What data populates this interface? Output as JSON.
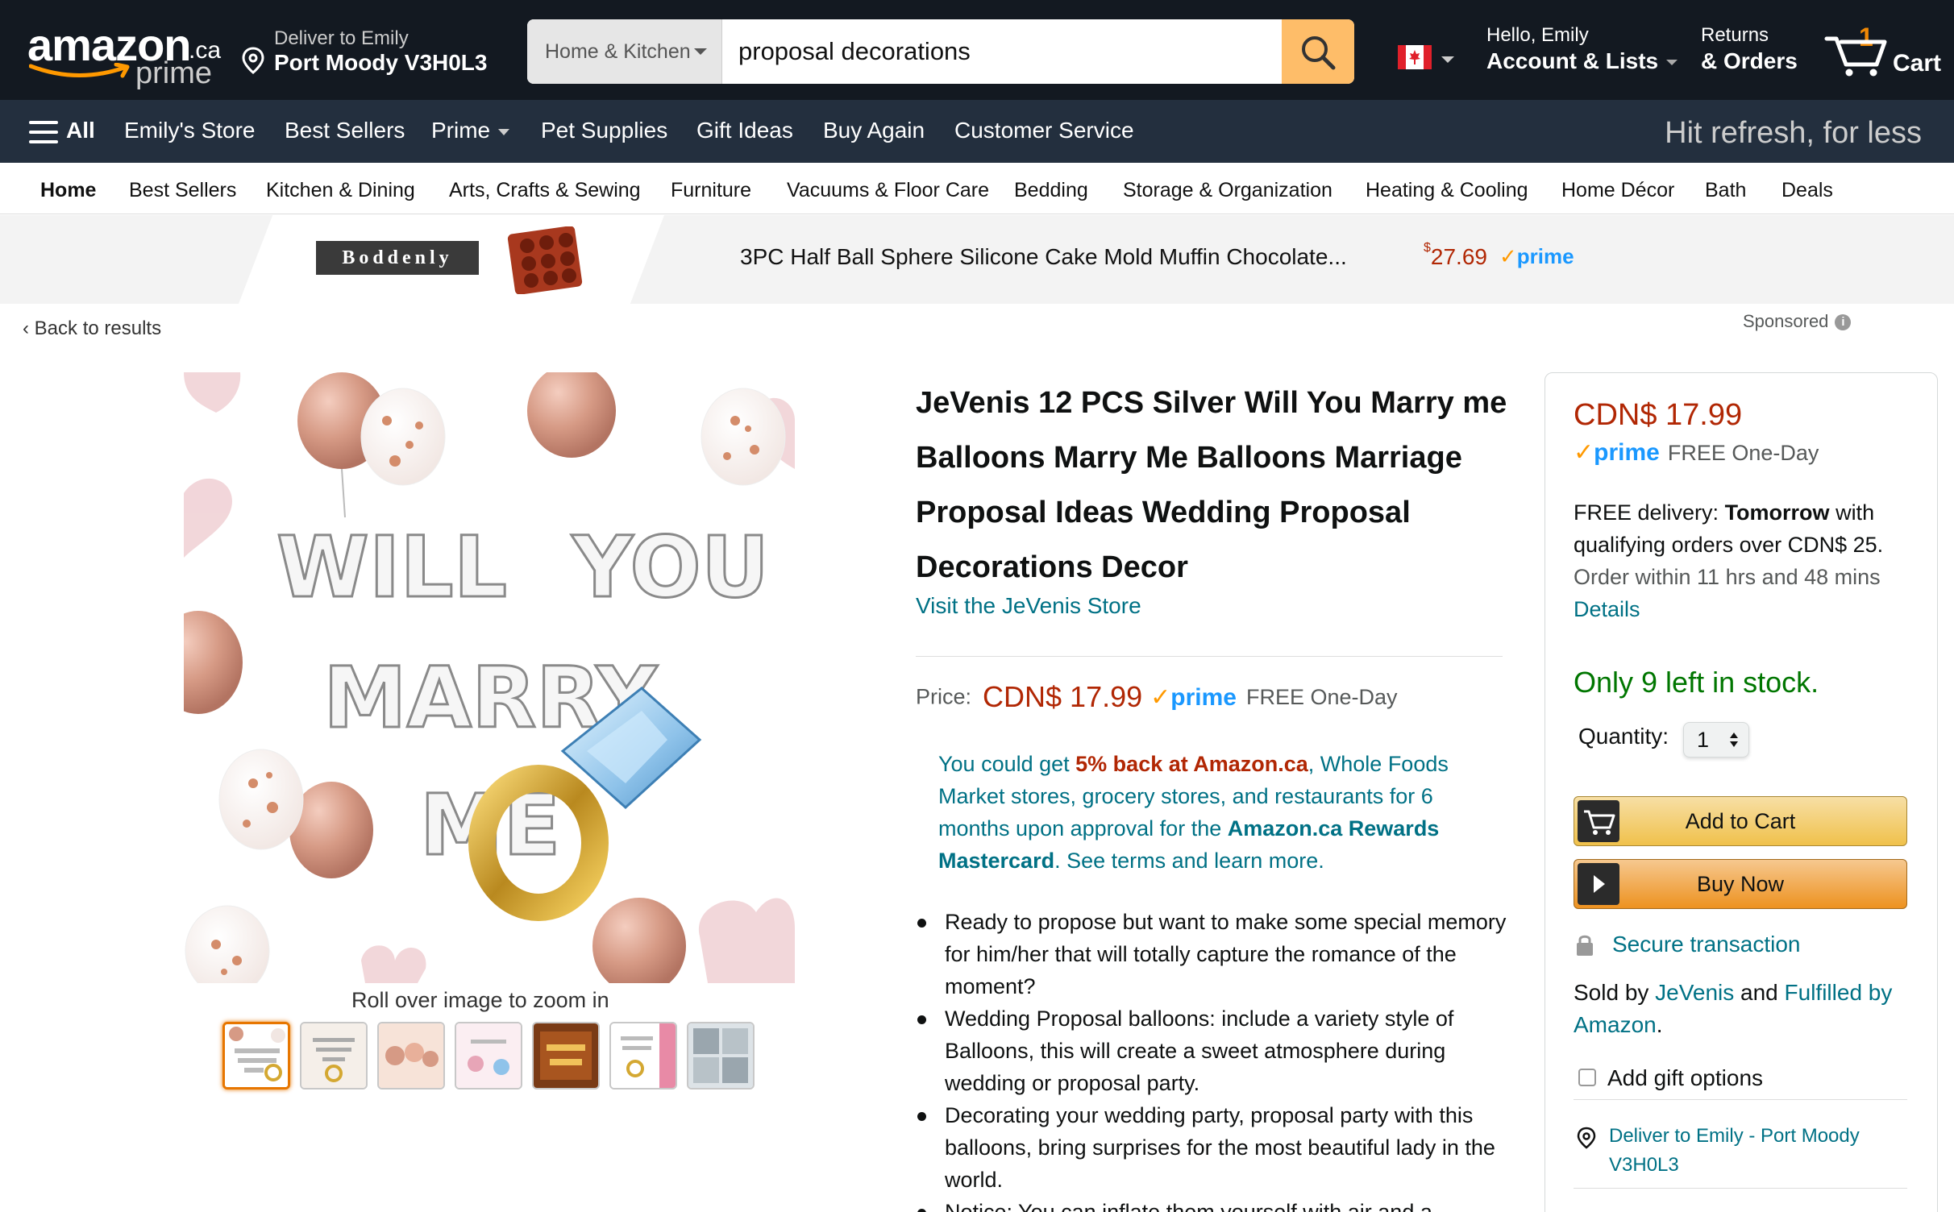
{
  "header": {
    "logo_word": "amazon",
    "logo_tld": ".ca",
    "logo_prime": "prime",
    "deliver_line1": "Deliver to Emily",
    "deliver_line2": "Port Moody V3H0L3",
    "search_category": "Home & Kitchen",
    "search_value": "proposal decorations",
    "account_line1": "Hello, Emily",
    "account_line2": "Account & Lists",
    "returns_line1": "Returns",
    "returns_line2": "& Orders",
    "cart_count": "1",
    "cart_label": "Cart"
  },
  "nav": {
    "all_label": "All",
    "items": [
      "Emily's Store",
      "Best Sellers",
      "Prime",
      "Pet Supplies",
      "Gift Ideas",
      "Buy Again",
      "Customer Service"
    ],
    "promo": "Hit refresh, for less"
  },
  "subnav": {
    "items": [
      "Home",
      "Best Sellers",
      "Kitchen & Dining",
      "Arts, Crafts & Sewing",
      "Furniture",
      "Vacuums & Floor Care",
      "Bedding",
      "Storage & Organization",
      "Heating & Cooling",
      "Home Décor",
      "Bath",
      "Deals"
    ]
  },
  "banner": {
    "brand": "Boddenly",
    "title": "3PC Half Ball Sphere Silicone Cake Mold Muffin Chocolate...",
    "price_symbol": "$",
    "price": "27.69",
    "prime": "prime"
  },
  "back_label": "Back to results",
  "sponsored_label": "Sponsored",
  "sponsored_info": "i",
  "image": {
    "rollover": "Roll over image to zoom in",
    "balloon_text": [
      "WILL YOU",
      "MARRY",
      "ME"
    ]
  },
  "product": {
    "title": "JeVenis 12 PCS Silver Will You Marry me Balloons Marry Me Balloons Marriage Proposal Ideas Wedding Proposal Decorations Decor",
    "store_link": "Visit the JeVenis Store",
    "price_label": "Price:",
    "price": "CDN$ 17.99",
    "prime": "prime",
    "free_shipping": "FREE One-Day",
    "promo_prefix": "You could get ",
    "promo_highlight": "5% back at Amazon.ca",
    "promo_middle": ", Whole Foods Market stores, grocery stores, and restaurants for 6 months upon approval for the ",
    "promo_card": "Amazon.ca Rewards Mastercard",
    "promo_suffix": ". See terms and learn more.",
    "bullets": [
      "Ready to propose but want to make some special memory for him/her that will totally capture the romance of the moment?",
      "Wedding Proposal balloons: include a variety style of Balloons, this will create a sweet atmosphere during wedding or proposal party.",
      "Decorating your wedding party, proposal party with this balloons, bring surprises for the most beautiful lady in the world.",
      "Notice: You can inflate them yourself with air and a"
    ]
  },
  "buybox": {
    "price": "CDN$ 17.99",
    "prime": "prime",
    "free_shipping": "FREE One-Day",
    "delivery_prefix": "FREE delivery: ",
    "delivery_day": "Tomorrow",
    "delivery_suffix": " with qualifying orders over CDN$ 25.",
    "order_within": "Order within 11 hrs and 48 mins",
    "details": "Details",
    "stock": "Only 9 left in stock.",
    "quantity_label": "Quantity:",
    "quantity_value": "1",
    "add_to_cart": "Add to Cart",
    "buy_now": "Buy Now",
    "secure": "Secure transaction",
    "sold_by_prefix": "Sold by ",
    "seller": "JeVenis",
    "sold_by_and": " and ",
    "fulfilled": "Fulfilled by Amazon",
    "sold_by_end": ".",
    "gift_options": "Add gift options",
    "deliver_to": "Deliver to Emily - Port Moody V3H0L3"
  },
  "colors": {
    "header_bg": "#131921",
    "nav_bg": "#232f3e",
    "price_red": "#b12704",
    "link_teal": "#007185",
    "stock_green": "#007600",
    "prime_blue": "#1a98ff",
    "search_button": "#febd69"
  }
}
